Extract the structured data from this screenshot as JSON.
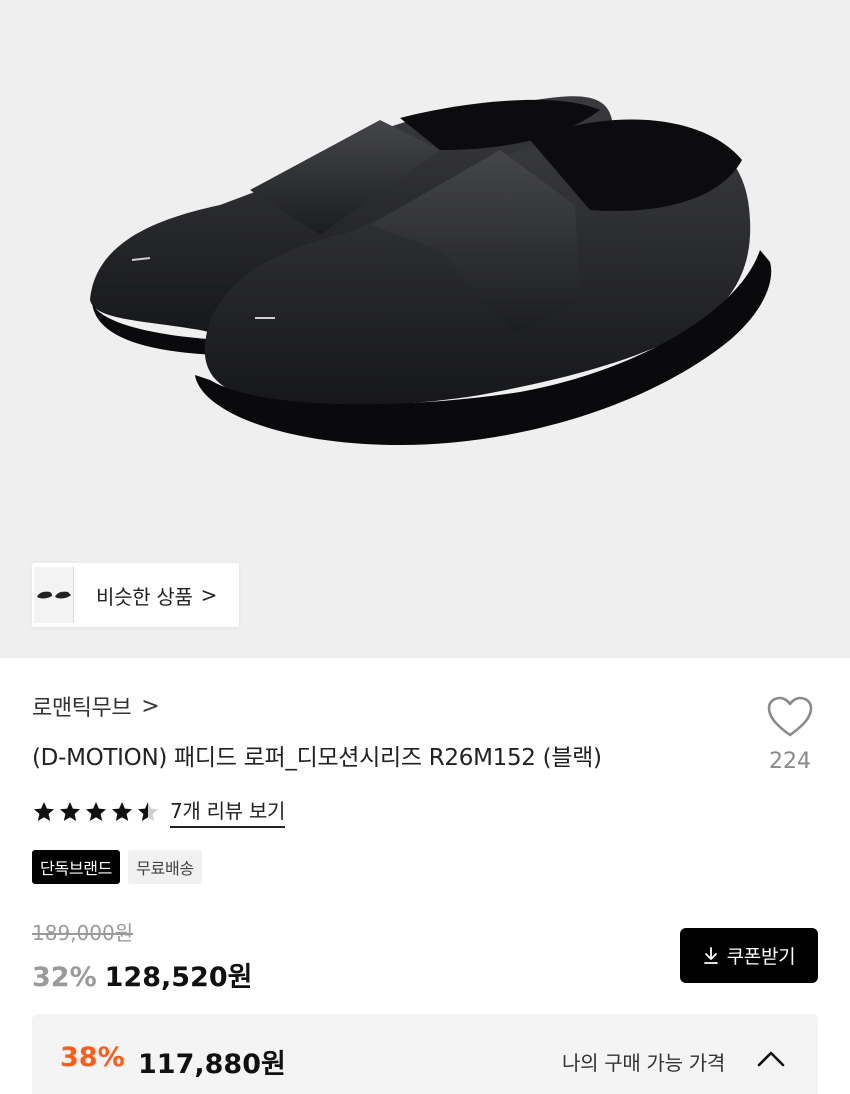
{
  "similar": {
    "label": "비슷한 상품",
    "chevron": ">"
  },
  "brand": {
    "name": "로맨틱무브",
    "chevron": ">"
  },
  "product": {
    "title": "(D-MOTION) 패디드 로퍼_디모션시리즈 R26M152 (블랙)"
  },
  "like": {
    "count": "224",
    "icon": "heart-icon"
  },
  "rating": {
    "stars": 4.5,
    "review_link": "7개 리뷰 보기"
  },
  "tags": [
    "단독브랜드",
    "무료배송"
  ],
  "price": {
    "original": "189,000원",
    "discount_pct": "32%",
    "sale": "128,520원"
  },
  "coupon": {
    "label": "쿠폰받기",
    "icon": "download-icon"
  },
  "my_price": {
    "discount_pct": "38%",
    "price": "117,880원",
    "label": "나의 구매 가능 가격",
    "icon": "chevron-up-icon"
  },
  "colors": {
    "accent_orange": "#ff5b1a",
    "muted_gray": "#9a9a9a",
    "black": "#000000"
  }
}
